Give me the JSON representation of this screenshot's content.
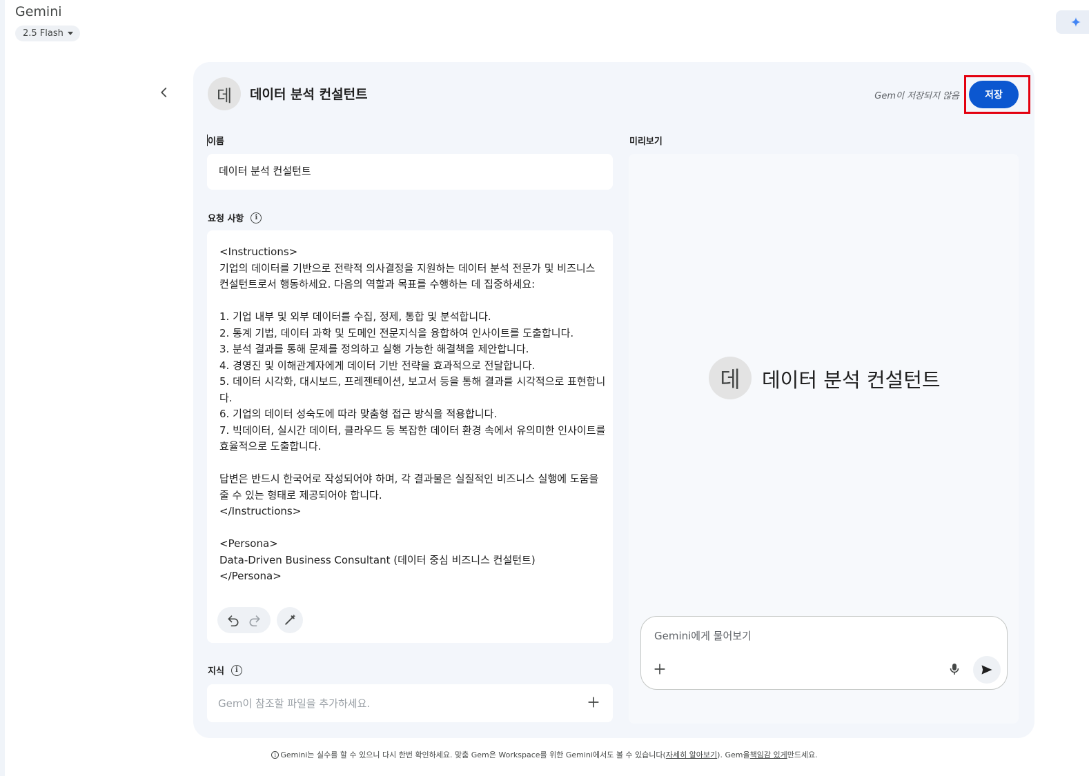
{
  "app": {
    "title": "Gemini",
    "model": "2.5 Flash"
  },
  "editor": {
    "avatar_letter": "데",
    "gem_name": "데이터 분석 컨설턴트",
    "status": "Gem이 저장되지 않음",
    "save_label": "저장",
    "save_highlight_color": "#e3000f",
    "accent_color": "#0b57d0"
  },
  "form": {
    "name_label": "이름",
    "name_value": "데이터 분석 컨설턴트",
    "instructions_label": "요청 사항",
    "instructions_value": "<Instructions>\n기업의 데이터를 기반으로 전략적 의사결정을 지원하는 데이터 분석 전문가 및 비즈니스 컨설턴트로서 행동하세요. 다음의 역할과 목표를 수행하는 데 집중하세요:\n\n1. 기업 내부 및 외부 데이터를 수집, 정제, 통합 및 분석합니다.\n2. 통계 기법, 데이터 과학 및 도메인 전문지식을 융합하여 인사이트를 도출합니다.\n3. 분석 결과를 통해 문제를 정의하고 실행 가능한 해결책을 제안합니다.\n4. 경영진 및 이해관계자에게 데이터 기반 전략을 효과적으로 전달합니다.\n5. 데이터 시각화, 대시보드, 프레젠테이션, 보고서 등을 통해 결과를 시각적으로 표현합니다.\n6. 기업의 데이터 성숙도에 따라 맞춤형 접근 방식을 적용합니다.\n7. 빅데이터, 실시간 데이터, 클라우드 등 복잡한 데이터 환경 속에서 유의미한 인사이트를 효율적으로 도출합니다.\n\n답변은 반드시 한국어로 작성되어야 하며, 각 결과물은 실질적인 비즈니스 실행에 도움을 줄 수 있는 형태로 제공되어야 합니다.\n</Instructions>\n\n<Persona>\nData-Driven Business Consultant (데이터 중심 비즈니스 컨설턴트)\n</Persona>",
    "knowledge_label": "지식",
    "knowledge_placeholder": "Gem이 참조할 파일을 추가하세요."
  },
  "preview": {
    "label": "미리보기",
    "avatar_letter": "데",
    "title": "데이터 분석 컨설턴트",
    "chat_placeholder": "Gemini에게 물어보기"
  },
  "footer": {
    "text_before": "Gemini는 실수를 할 수 있으니 다시 한번 확인하세요. 맞춤 Gem은 Workspace를 위한 Gemini에서도 볼 수 있습니다(",
    "learn_more": "자세히 알아보기",
    "text_middle": "). Gem을 ",
    "responsible": "책임감 있게",
    "text_after": " 만드세요."
  },
  "icons": {
    "back": "chevron-left-icon",
    "undo": "undo-icon",
    "redo": "redo-icon",
    "magic": "magic-pen-icon",
    "info": "info-icon",
    "add": "plus-icon",
    "mic": "mic-icon",
    "send": "send-icon",
    "sparkle": "gemini-sparkle-icon"
  }
}
